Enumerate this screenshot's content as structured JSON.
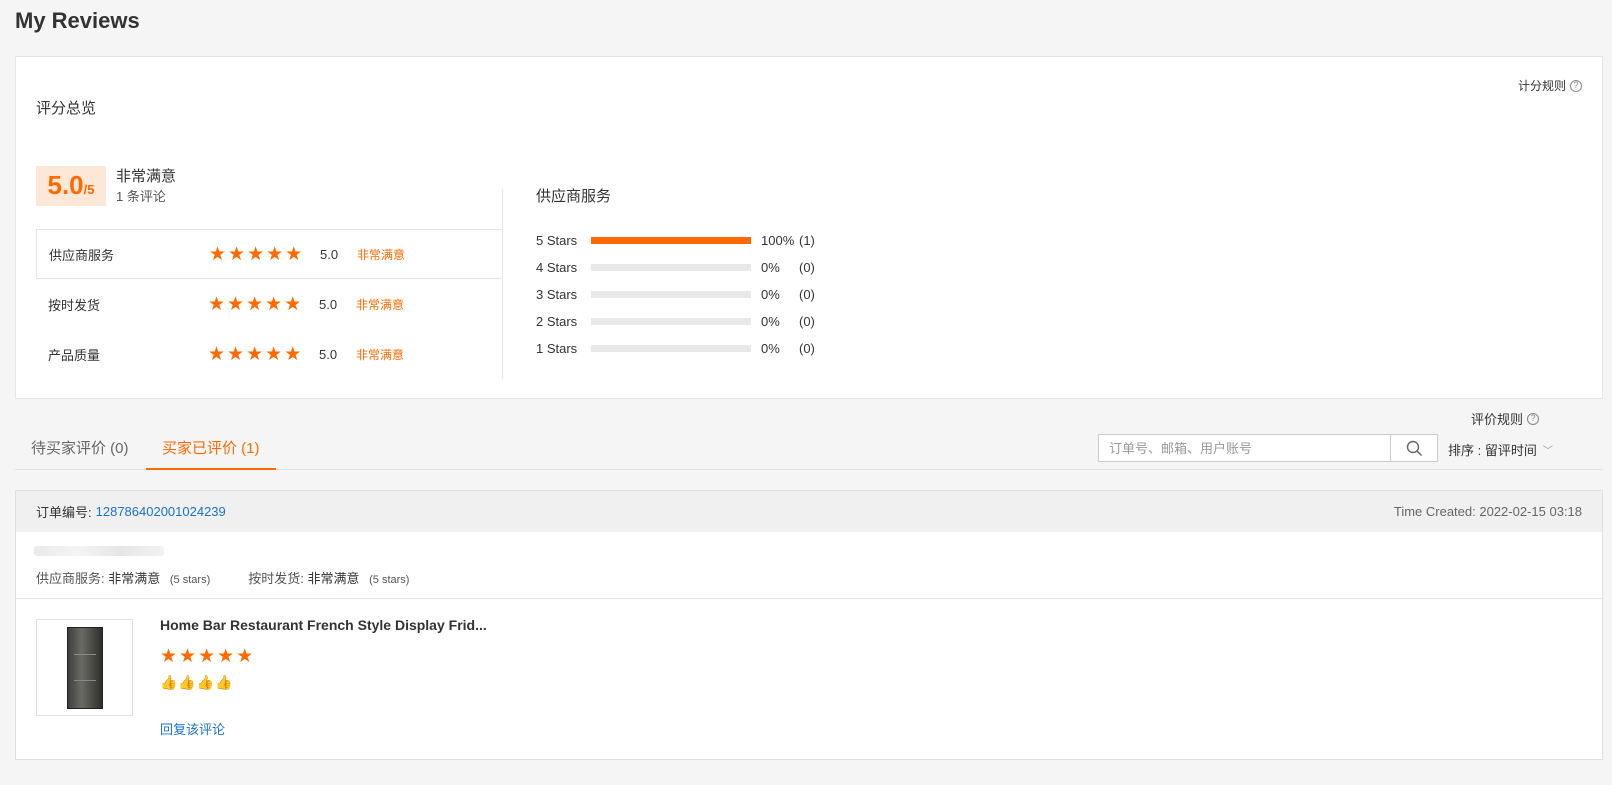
{
  "page": {
    "title": "My Reviews"
  },
  "overview": {
    "title": "评分总览",
    "rules_link": "计分规则",
    "help_glyph": "?",
    "score": "5.0",
    "score_max": "/5",
    "score_text": "非常满意",
    "review_count": "1 条评论",
    "ratings": [
      {
        "label": "供应商服务",
        "stars": 5,
        "value": "5.0",
        "text": "非常满意"
      },
      {
        "label": "按时发货",
        "stars": 5,
        "value": "5.0",
        "text": "非常满意"
      },
      {
        "label": "产品质量",
        "stars": 5,
        "value": "5.0",
        "text": "非常满意"
      }
    ],
    "distribution_title": "供应商服务",
    "distribution": [
      {
        "label": "5  Stars",
        "pct": "100%",
        "count": "(1)",
        "fill": 1.0
      },
      {
        "label": "4  Stars",
        "pct": "0%",
        "count": "(0)",
        "fill": 0
      },
      {
        "label": "3  Stars",
        "pct": "0%",
        "count": "(0)",
        "fill": 0
      },
      {
        "label": "2  Stars",
        "pct": "0%",
        "count": "(0)",
        "fill": 0
      },
      {
        "label": "1  Stars",
        "pct": "0%",
        "count": "(0)",
        "fill": 0
      }
    ]
  },
  "reviews": {
    "rules_link": "评价规则",
    "tabs": [
      {
        "label": "待买家评价 (0)",
        "active": false
      },
      {
        "label": "买家已评价 (1)",
        "active": true
      }
    ],
    "search_placeholder": "订单号、邮箱、用户账号",
    "sort_label": "排序 : 留评时间",
    "chevron": "﹀"
  },
  "order": {
    "number_label": "订单编号:",
    "number": "128786402001024239",
    "time_created": "Time Created: 2022-02-15 03:18",
    "supplier_service_label": "供应商服务:",
    "supplier_service_value": "非常满意",
    "supplier_service_stars": "(5 stars)",
    "delivery_label": "按时发货:",
    "delivery_value": "非常满意",
    "delivery_stars": "(5 stars)",
    "product_title": "Home Bar Restaurant French Style Display Frid...",
    "product_stars": 5,
    "thumbs": "👍👍👍👍",
    "reply_link": "回复该评论"
  },
  "colors": {
    "accent": "#ff6a00",
    "link": "#1a73c8"
  }
}
